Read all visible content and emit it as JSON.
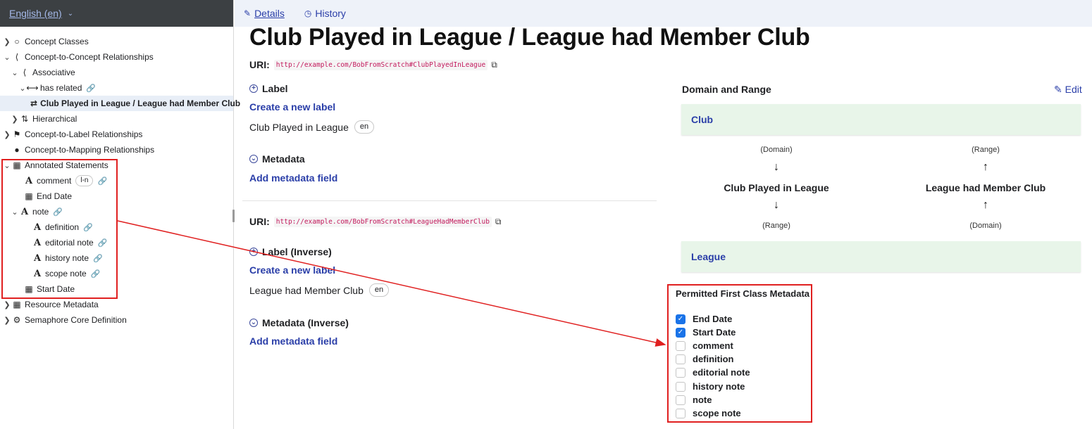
{
  "sidebar": {
    "language": "English (en)",
    "tree": [
      {
        "label": "Concept Classes"
      },
      {
        "label": "Concept-to-Concept Relationships"
      },
      {
        "label": "Associative"
      },
      {
        "label": "has related"
      },
      {
        "label": "Club Played in League / League had Member Club"
      },
      {
        "label": "Hierarchical"
      },
      {
        "label": "Concept-to-Label Relationships"
      },
      {
        "label": "Concept-to-Mapping Relationships"
      },
      {
        "label": "Annotated Statements"
      },
      {
        "label": "comment",
        "tag": "l-n"
      },
      {
        "label": "End Date"
      },
      {
        "label": "note"
      },
      {
        "label": "definition"
      },
      {
        "label": "editorial note"
      },
      {
        "label": "history note"
      },
      {
        "label": "scope note"
      },
      {
        "label": "Start Date"
      },
      {
        "label": "Resource Metadata"
      },
      {
        "label": "Semaphore Core Definition"
      }
    ]
  },
  "tabs": [
    {
      "label": "Details"
    },
    {
      "label": "History"
    }
  ],
  "main": {
    "title": "Club Played in League / League had Member Club",
    "uri_label": "URI:",
    "uri": "http://example.com/BobFromScratch#ClubPlayedInLeague",
    "label_heading": "Label",
    "create_label": "Create a new label",
    "label_value": "Club Played in League",
    "label_lang": "en",
    "metadata_heading": "Metadata",
    "add_metadata": "Add metadata field",
    "inverse_uri_label": "URI:",
    "inverse_uri": "http://example.com/BobFromScratch#LeagueHadMemberClub",
    "inverse_label_heading": "Label (Inverse)",
    "inverse_create_label": "Create a new label",
    "inverse_label_value": "League had Member Club",
    "inverse_label_lang": "en",
    "inverse_metadata_heading": "Metadata (Inverse)",
    "inverse_add_metadata": "Add metadata field"
  },
  "domain_range": {
    "title": "Domain and Range",
    "edit": "Edit",
    "top_box": "Club",
    "bottom_box": "League",
    "left_col": {
      "top": "(Domain)",
      "name": "Club Played in League",
      "bottom": "(Range)"
    },
    "right_col": {
      "top": "(Range)",
      "name": "League had Member Club",
      "bottom": "(Domain)"
    }
  },
  "permitted": {
    "title": "Permitted First Class Metadata",
    "items": [
      {
        "label": "End Date",
        "checked": true
      },
      {
        "label": "Start Date",
        "checked": true
      },
      {
        "label": "comment",
        "checked": false
      },
      {
        "label": "definition",
        "checked": false
      },
      {
        "label": "editorial note",
        "checked": false
      },
      {
        "label": "history note",
        "checked": false
      },
      {
        "label": "note",
        "checked": false
      },
      {
        "label": "scope note",
        "checked": false
      }
    ]
  },
  "colors": {
    "accent": "#2a3ea8",
    "checkbox": "#1a73e8",
    "annotation": "#e02020",
    "box_bg": "#e8f5e9"
  }
}
